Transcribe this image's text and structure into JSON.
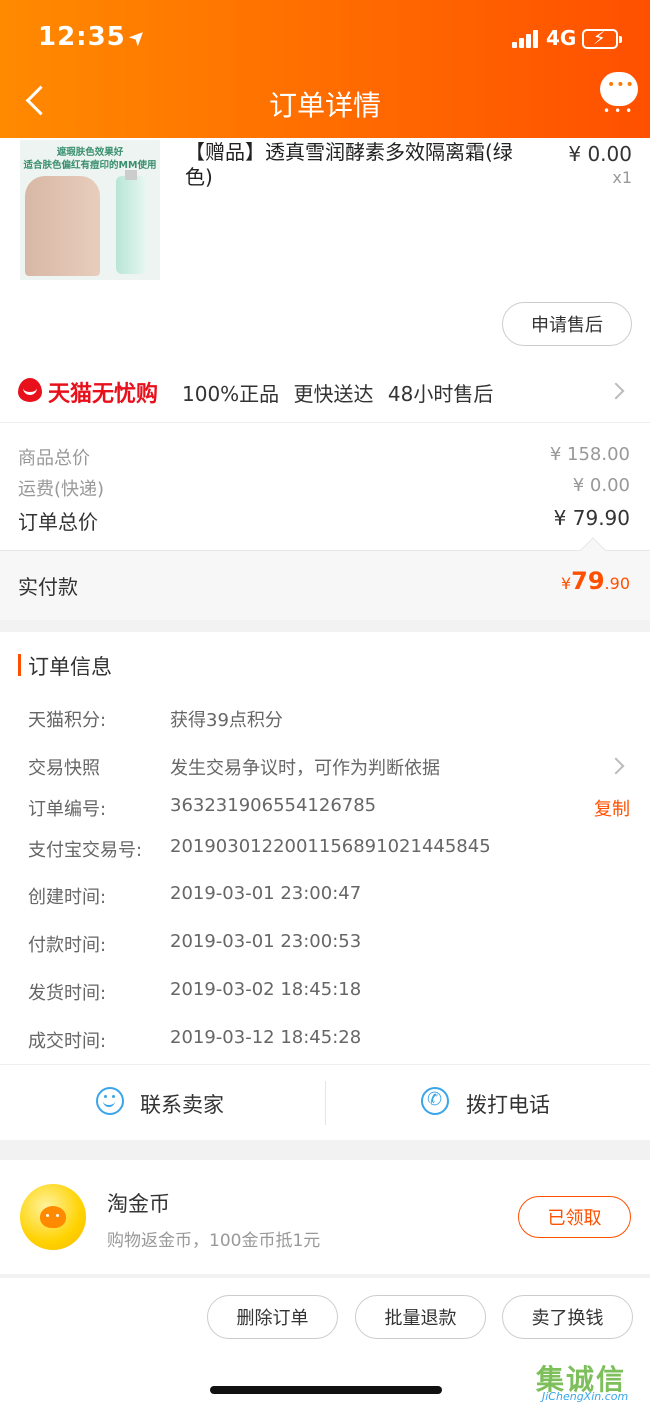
{
  "status_bar": {
    "time": "12:35",
    "network": "4G"
  },
  "header": {
    "title": "订单详情"
  },
  "product": {
    "image_caption_1": "遮瑕肤色效果好",
    "image_caption_2": "适合肤色偏红有痘印的MM使用",
    "name": "【赠品】透真雪润酵素多效隔离霜(绿色)",
    "price": "¥ 0.00",
    "quantity": "x1",
    "after_sale_button": "申请售后"
  },
  "tmall": {
    "brand": "天猫无忧购",
    "features": "100%正品 更快送达 48小时售后"
  },
  "pricing": {
    "goods_total_label": "商品总价",
    "goods_total_value": "¥ 158.00",
    "shipping_label": "运费(快递)",
    "shipping_value": "¥ 0.00",
    "order_total_label": "订单总价",
    "order_total_value": "¥ 79.90",
    "paid_label": "实付款",
    "paid_currency": "¥",
    "paid_integer": "79",
    "paid_decimal": ".90"
  },
  "order_info": {
    "section_title": "订单信息",
    "rows": [
      {
        "label": "天猫积分:",
        "value": "获得39点积分"
      },
      {
        "label": "交易快照",
        "value": "发生交易争议时，可作为判断依据"
      },
      {
        "label": "订单编号:",
        "value": "363231906554126785",
        "action": "复制"
      },
      {
        "label": "支付宝交易号:",
        "value": "2019030122001156891021445845"
      },
      {
        "label": "创建时间:",
        "value": "2019-03-01 23:00:47"
      },
      {
        "label": "付款时间:",
        "value": "2019-03-01 23:00:53"
      },
      {
        "label": "发货时间:",
        "value": "2019-03-02 18:45:18"
      },
      {
        "label": "成交时间:",
        "value": "2019-03-12 18:45:28"
      }
    ]
  },
  "contact": {
    "seller_label": "联系卖家",
    "phone_label": "拨打电话"
  },
  "coins": {
    "title": "淘金币",
    "subtitle": "购物返金币，100金币抵1元",
    "button": "已领取"
  },
  "footer_actions": {
    "delete": "删除订单",
    "batch_refund": "批量退款",
    "resell": "卖了换钱"
  },
  "watermark": {
    "cn": "集诚信",
    "en": "JiChengXin.com"
  },
  "colors": {
    "accent": "#ff5000",
    "tmall_red": "#e8101b",
    "link_blue": "#3aa5e8"
  }
}
